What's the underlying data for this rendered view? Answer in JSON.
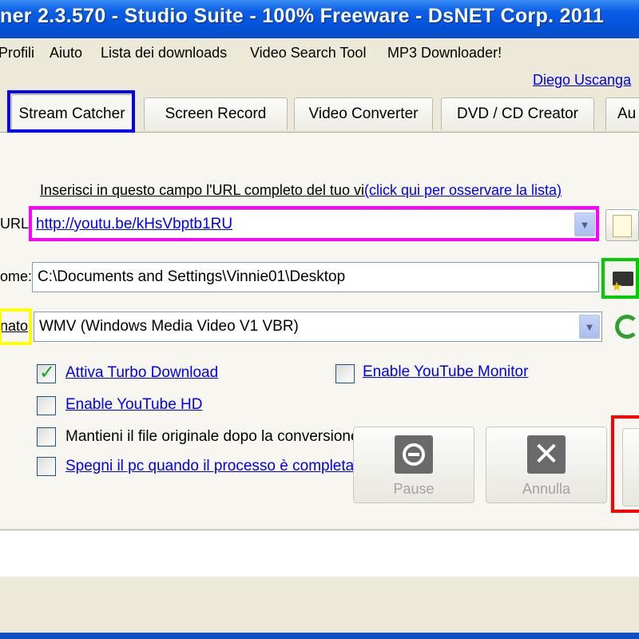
{
  "window": {
    "title": "ner 2.3.570 - Studio Suite - 100% Freeware - DsNET Corp. 2011"
  },
  "menu": [
    "Profili",
    "Aiuto",
    "Lista dei downloads",
    "Video Search Tool",
    "MP3 Downloader!"
  ],
  "author_link": "Diego Uscanga",
  "tabs": [
    "Stream Catcher",
    "Screen Record",
    "Video Converter",
    "DVD / CD Creator",
    "Au"
  ],
  "active_tab": "Stream Catcher",
  "instructions": {
    "text": "Inserisci in questo campo l'URL completo del tuo vi",
    "link": "(click qui per osservare la lista)"
  },
  "url_field": {
    "label": "URL",
    "value": "http://youtu.be/kHsVbptb1RU"
  },
  "path_field": {
    "label": "ome:",
    "value": "C:\\Documents and Settings\\Vinnie01\\Desktop"
  },
  "format_field": {
    "label": "nato",
    "value": "WMV (Windows Media Video V1 VBR)"
  },
  "options": [
    {
      "label": "Attiva Turbo Download",
      "checked": true,
      "link": true
    },
    {
      "label": "Enable YouTube HD",
      "checked": false,
      "link": true
    },
    {
      "label": "Mantieni il file originale dopo la conversione",
      "checked": false,
      "link": false
    },
    {
      "label": "Spegni il pc quando il processo è completa",
      "checked": false,
      "link": true
    },
    {
      "label": "Enable YouTube Monitor",
      "checked": false,
      "link": true
    }
  ],
  "buttons": {
    "pause": "Pause",
    "cancel": "Annulla"
  },
  "highlight_colors": {
    "tab": "#0000ff",
    "url": "#ff00ff",
    "folder": "#00cc00",
    "format": "#ffff00",
    "start": "#ff0000"
  }
}
